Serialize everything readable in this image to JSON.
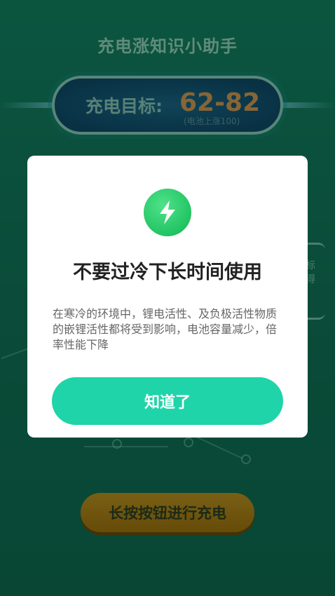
{
  "app": {
    "title": "充电涨知识小助手",
    "target_label": "充电目标:",
    "target_value": "62-82",
    "target_sub": "(电池上涨100)",
    "side_chars": [
      "标",
      "得"
    ],
    "charge_button_label": "长按按钮进行充电"
  },
  "dialog": {
    "icon": "lightning-bolt-icon",
    "title": "不要过冷下长时间使用",
    "body": "在寒冷的环境中，锂电活性、及负极活性物质的嵌锂活性都将受到影响，电池容量减少，倍率性能下降",
    "button_label": "知道了"
  },
  "colors": {
    "background": "#117d5e",
    "dialog_button": "#1fd4a8",
    "icon_green": "#22c463",
    "charge_button": "#b88a18"
  }
}
